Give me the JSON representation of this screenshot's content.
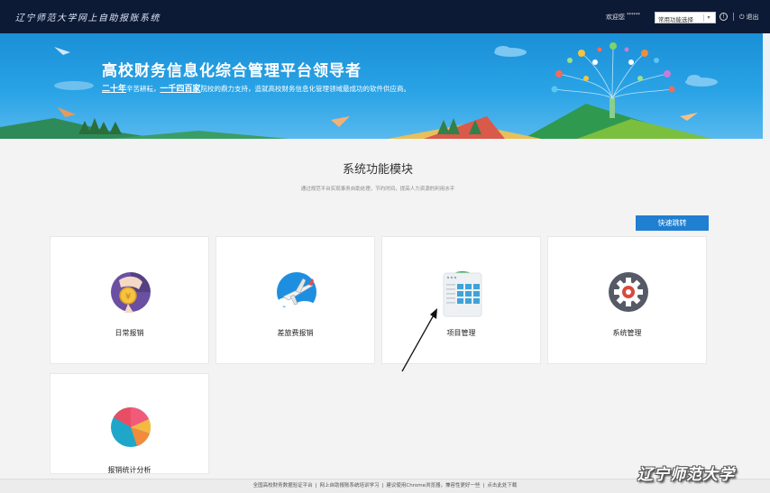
{
  "header": {
    "system_title": "辽宁师范大学网上自助报账系统",
    "welcome_label": "欢迎您",
    "username": "******",
    "function_select": "常用功能选择",
    "info_symbol": "!",
    "logout_label": "退出"
  },
  "banner": {
    "headline": "高校财务信息化综合管理平台领导者",
    "subline_em1": "二十年",
    "subline_1": "辛苦耕耘，",
    "subline_em2": "一千四百家",
    "subline_2": "院校的鼎力支持，造就高校财务信息化管理领域最成功的软件供应商。"
  },
  "section": {
    "title": "系统功能模块",
    "subtitle": "通过规范平台实现事务自助处理，节约时间，提高人力资源的利用水平",
    "quick_jump": "快速跳转"
  },
  "modules": [
    {
      "label": "日常报销",
      "icon": "coin-hand-icon",
      "color": "#6a4fa3"
    },
    {
      "label": "差旅费报销",
      "icon": "airplane-icon",
      "color": "#1e8fe0"
    },
    {
      "label": "项目管理",
      "icon": "grid-document-icon",
      "color": "#3fa3d9"
    },
    {
      "label": "系统管理",
      "icon": "gear-icon",
      "color": "#555a66"
    },
    {
      "label": "报销统计分析",
      "icon": "pie-chart-icon",
      "color": "#f0534f"
    }
  ],
  "footer": {
    "items": [
      "全国高校财务数据验证平台",
      "网上自助报账系统培训学习",
      "建议使用Chrome浏览器，兼容性更好一些",
      "点击此处下载"
    ]
  },
  "watermark": "辽宁师范大学",
  "colors": {
    "topbar": "#0d1a35",
    "banner": "#1a8fd6",
    "accent": "#1f7fd0"
  }
}
